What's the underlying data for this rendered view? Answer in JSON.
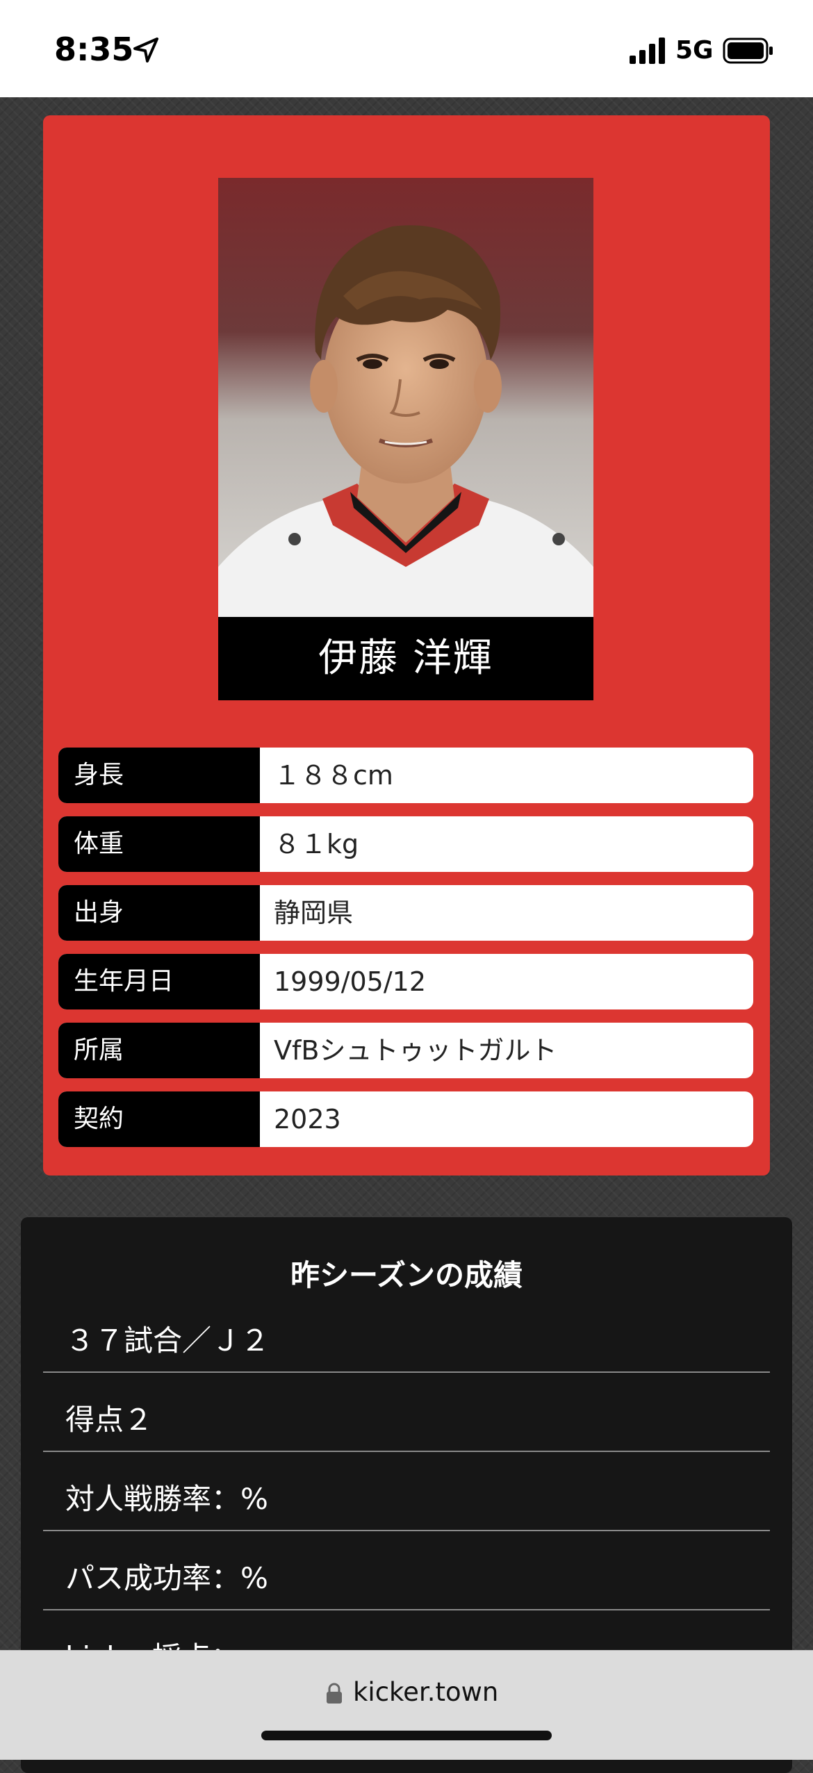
{
  "status_bar": {
    "time": "8:35",
    "network": "5G",
    "icons": [
      "location-arrow-icon",
      "signal-icon",
      "battery-icon"
    ]
  },
  "profile": {
    "name": "伊藤 洋輝",
    "photo": "player-portrait-photo",
    "details": [
      {
        "label": "身長",
        "value": "１８８cm"
      },
      {
        "label": "体重",
        "value": "８１kg"
      },
      {
        "label": "出身",
        "value": "静岡県"
      },
      {
        "label": "生年月日",
        "value": "1999/05/12"
      },
      {
        "label": "所属",
        "value": "VfBシュトゥットガルト"
      },
      {
        "label": "契約",
        "value": "2023"
      }
    ]
  },
  "stats": {
    "title": "昨シーズンの成績",
    "items": [
      "３７試合／Ｊ２",
      "得点２",
      "対人戦勝率：%",
      "パス成功率：%",
      "kicker採点："
    ]
  },
  "browser": {
    "url": "kicker.town"
  },
  "colors": {
    "card_red": "#dc3631",
    "label_black": "#000000",
    "panel_dark": "#161616",
    "page_bg": "#3a3a3a"
  }
}
